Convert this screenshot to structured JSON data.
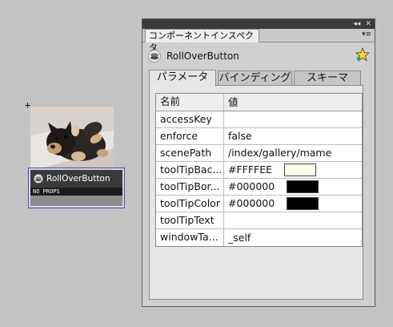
{
  "stage": {
    "crosshair_glyph": "+",
    "component": {
      "label": "RollOverButton",
      "sublabel": "NO PROPS"
    }
  },
  "panel": {
    "tab_label": "コンポーネントインスペクタ",
    "title": "RollOverButton",
    "top_controls": [
      "◂◂",
      "✕"
    ],
    "menu_glyph": "▾≡",
    "sub_tabs": [
      "パラメータ",
      "バインディング",
      "スキーマ"
    ],
    "active_sub_tab": "パラメータ",
    "grid": {
      "headers": {
        "name": "名前",
        "value": "値"
      },
      "rows": [
        {
          "name": "accessKey",
          "value": ""
        },
        {
          "name": "enforce",
          "value": "false"
        },
        {
          "name": "scenePath",
          "value": "/index/gallery/mame"
        },
        {
          "name": "toolTipBac...",
          "value": "#FFFFEE",
          "swatch": "#FFFFEE"
        },
        {
          "name": "toolTipBor...",
          "value": "#000000",
          "swatch": "#000000"
        },
        {
          "name": "toolTipColor",
          "value": "#000000",
          "swatch": "#000000"
        },
        {
          "name": "toolTipText",
          "value": ""
        },
        {
          "name": "windowTa...",
          "value": "_self"
        }
      ]
    }
  },
  "colors": {
    "background": "#c4c4c4",
    "selection_border": "#4b4bb0"
  }
}
